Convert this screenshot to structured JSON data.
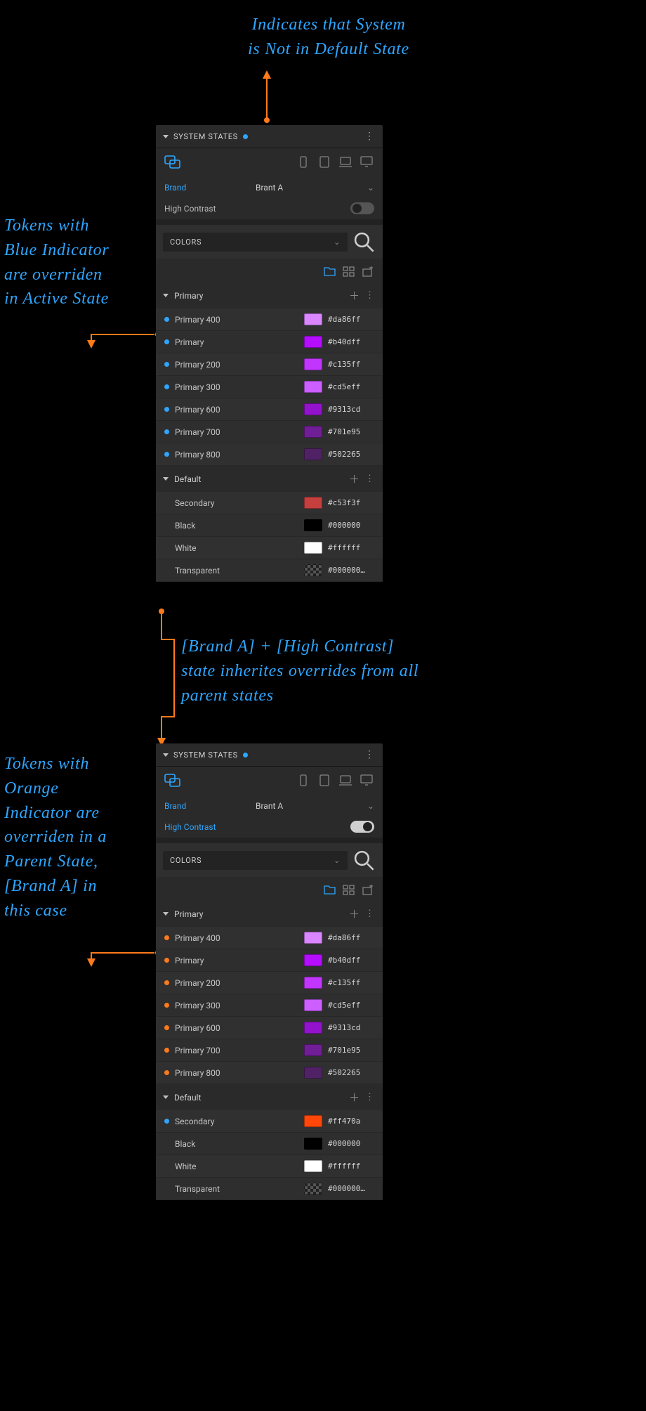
{
  "notes": {
    "n1": "Indicates that System\nis Not in Default State",
    "n2": "Tokens with\nBlue Indicator\nare overriden\nin Active State",
    "n3": "[Brand A] + [High Contrast]\nstate inherites overrides from all\nparent states",
    "n4": "Tokens with\nOrange\nIndicator are\noverriden in a\nParent State,\n[Brand A] in\nthis case"
  },
  "panels": [
    {
      "title": "SYSTEM STATES",
      "brandKey": "Brand",
      "brandValue": "Brant A",
      "contrastKey": "High Contrast",
      "contrastOn": false,
      "contrastKeyBlue": false,
      "colorsLabel": "COLORS",
      "groups": [
        {
          "name": "Primary",
          "tokens": [
            {
              "ind": "blue",
              "name": "Primary 400",
              "hex": "#da86ff"
            },
            {
              "ind": "blue",
              "name": "Primary",
              "hex": "#b40dff"
            },
            {
              "ind": "blue",
              "name": "Primary 200",
              "hex": "#c135ff"
            },
            {
              "ind": "blue",
              "name": "Primary 300",
              "hex": "#cd5eff"
            },
            {
              "ind": "blue",
              "name": "Primary 600",
              "hex": "#9313cd"
            },
            {
              "ind": "blue",
              "name": "Primary 700",
              "hex": "#701e95"
            },
            {
              "ind": "blue",
              "name": "Primary 800",
              "hex": "#502265"
            }
          ]
        },
        {
          "name": "Default",
          "tokens": [
            {
              "ind": "none",
              "name": "Secondary",
              "hex": "#c53f3f"
            },
            {
              "ind": "none",
              "name": "Black",
              "hex": "#000000"
            },
            {
              "ind": "none",
              "name": "White",
              "hex": "#ffffff"
            },
            {
              "ind": "none",
              "name": "Transparent",
              "hex": "#000000…",
              "checker": true
            }
          ]
        }
      ]
    },
    {
      "title": "SYSTEM STATES",
      "brandKey": "Brand",
      "brandValue": "Brant A",
      "contrastKey": "High Contrast",
      "contrastOn": true,
      "contrastKeyBlue": true,
      "colorsLabel": "COLORS",
      "groups": [
        {
          "name": "Primary",
          "tokens": [
            {
              "ind": "orange",
              "name": "Primary 400",
              "hex": "#da86ff"
            },
            {
              "ind": "orange",
              "name": "Primary",
              "hex": "#b40dff"
            },
            {
              "ind": "orange",
              "name": "Primary 200",
              "hex": "#c135ff"
            },
            {
              "ind": "orange",
              "name": "Primary 300",
              "hex": "#cd5eff"
            },
            {
              "ind": "orange",
              "name": "Primary 600",
              "hex": "#9313cd"
            },
            {
              "ind": "orange",
              "name": "Primary 700",
              "hex": "#701e95"
            },
            {
              "ind": "orange",
              "name": "Primary 800",
              "hex": "#502265"
            }
          ]
        },
        {
          "name": "Default",
          "tokens": [
            {
              "ind": "blue",
              "name": "Secondary",
              "hex": "#ff470a"
            },
            {
              "ind": "none",
              "name": "Black",
              "hex": "#000000"
            },
            {
              "ind": "none",
              "name": "White",
              "hex": "#ffffff"
            },
            {
              "ind": "none",
              "name": "Transparent",
              "hex": "#000000…",
              "checker": true
            }
          ]
        }
      ]
    }
  ]
}
